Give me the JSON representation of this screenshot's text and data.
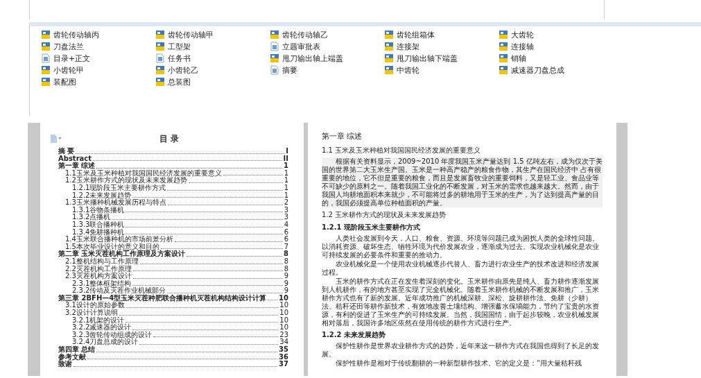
{
  "files": [
    {
      "name": "齿轮传动轴丙",
      "kind": "drawing"
    },
    {
      "name": "齿轮传动轴甲",
      "kind": "drawing"
    },
    {
      "name": "齿轮传动轴乙",
      "kind": "drawing"
    },
    {
      "name": "齿轮组箱体",
      "kind": "drawing"
    },
    {
      "name": "大齿轮",
      "kind": "drawing"
    },
    {
      "name": "刀盘法兰",
      "kind": "drawing"
    },
    {
      "name": "工型架",
      "kind": "drawing"
    },
    {
      "name": "立题审批表",
      "kind": "document"
    },
    {
      "name": "连接架",
      "kind": "drawing"
    },
    {
      "name": "连接轴",
      "kind": "drawing"
    },
    {
      "name": "目录+正文",
      "kind": "document"
    },
    {
      "name": "任务书",
      "kind": "document"
    },
    {
      "name": "甩刀输出轴上端盖",
      "kind": "drawing"
    },
    {
      "name": "甩刀输出轴下端盖",
      "kind": "drawing"
    },
    {
      "name": "销轴",
      "kind": "drawing"
    },
    {
      "name": "小齿轮甲",
      "kind": "drawing"
    },
    {
      "name": "小齿轮乙",
      "kind": "drawing"
    },
    {
      "name": "摘要",
      "kind": "document"
    },
    {
      "name": "中齿轮",
      "kind": "drawing"
    },
    {
      "name": "减速器刀盘总成",
      "kind": "drawing"
    },
    {
      "name": "装配图",
      "kind": "drawing"
    },
    {
      "name": "总装图",
      "kind": "drawing"
    }
  ],
  "toc": {
    "title": "目 录",
    "entries": [
      {
        "label": "摘 要",
        "page": "I"
      },
      {
        "label": "Abstract",
        "page": "II"
      },
      {
        "label": "第一章 综述",
        "page": "1",
        "children": [
          {
            "label": "1.1玉米及玉米种植对我国国民经济发展的重要意义",
            "page": "1"
          },
          {
            "label": "1.2玉米耕作方式的现状及未来发展趋势",
            "page": "1",
            "children": [
              {
                "label": "1.2.1现阶段玉米主要耕作方式",
                "page": "1"
              },
              {
                "label": "1.2.2未来发展趋势",
                "page": "1"
              }
            ]
          },
          {
            "label": "1.3玉米播种机械发展历程与特点",
            "page": "2",
            "children": [
              {
                "label": "1.3.1谷物条播机",
                "page": "3"
              },
              {
                "label": "1.3.2点播机",
                "page": "3"
              },
              {
                "label": "1.3.3联合播种机",
                "page": "4"
              },
              {
                "label": "1.3.4免耕播种机",
                "page": "6"
              }
            ]
          },
          {
            "label": "1.4玉米联合播种机的市场前景分析",
            "page": "6"
          },
          {
            "label": "1.5本次毕业设计的意义和目的",
            "page": "7"
          }
        ]
      },
      {
        "label": "第二章 玉米灭茬机构工作原理及方案设计",
        "page": "8",
        "children": [
          {
            "label": "2.1整机结构与工作原理",
            "page": "8"
          },
          {
            "label": "2.2灭茬机构工作原理",
            "page": "8"
          },
          {
            "label": "2.3灭茬机构方案设计",
            "page": "9",
            "children": [
              {
                "label": "2.3.1整体框架结构",
                "page": "9"
              },
              {
                "label": "2.3.2传动及灭茬作业机械部分",
                "page": "9"
              }
            ]
          }
        ]
      },
      {
        "label": "第三章 2BFH—4型玉米灭茬种肥联合播种机灭茬机构结构设计计算",
        "page": "10",
        "children": [
          {
            "label": "3.1设计的原始参数",
            "page": "10"
          },
          {
            "label": "3.2设计计算说明",
            "page": "10",
            "children": [
              {
                "label": "3.2.1机架的设计",
                "page": "10"
              },
              {
                "label": "3.2.2减速器的设计",
                "page": "10"
              },
              {
                "label": "3.2.3齿轮传动组成的设计",
                "page": "23"
              },
              {
                "label": "3.2.4刀盘总成的设计",
                "page": "34"
              }
            ]
          }
        ]
      },
      {
        "label": "第四章 总结",
        "page": "35"
      },
      {
        "label": "参考文献",
        "page": "36"
      },
      {
        "label": "致谢",
        "page": "37"
      }
    ]
  },
  "body": [
    {
      "kind": "chapter",
      "text": "第一章 综述"
    },
    {
      "kind": "section",
      "text": "1.1 玉米及玉米种植对我国国民经济发展的重要意义"
    },
    {
      "kind": "shaded_paragraph",
      "text": "根据有关资料显示，2009~2010 年度我国玉米产量达到 1.5 亿吨左右，成为仅次于美国的世界第二大玉米生产国。玉米是一种高产稳产的粮食作物，其生产在国民经济中 占有很重要的地位，它不但是重要的粮食，而且是发展畜牧业的重要饲料，又是轻工业、食品业等不可缺少的原料之一。随着我国工业化的不断发展，对玉米的需求也越来越大。然而，由于我国人均耕地面积本来就少，不可能将过多的耕地用于玉米的生产，为了达到提高产量的目的，我国必须提高单位种植面积的产量。"
    },
    {
      "kind": "section",
      "text": "1.2 玉米耕作方式的现状及未来发展趋势"
    },
    {
      "kind": "subsection",
      "text": "1.2.1 现阶段玉米主要耕作方式"
    },
    {
      "kind": "paragraph",
      "text": "人类社会发展到今天，人口、粮食、资源、环境等问题已成为困扰人类的全球性问题。以消耗资源、破坏生态、牺牲环境为代价发展农业，逐渐成为过去。实现农业机械化是农业可持续发展的必要条件和重要的推动力。"
    },
    {
      "kind": "paragraph",
      "text": "农业机械化是一个使用农业机械逐步代替人、畜力进行农业生产的技术改进和经济发展过程。"
    },
    {
      "kind": "paragraph",
      "text": "玉米的耕作方式在正在发生着深刻的变化。玉米耕作由原先是纯人、畜力耕作逐渐发展到人机耕作，有的地方甚至实现了完全机械化。随着玉米耕作机械的不断发展和推广，玉米耕作方式也有了新的发展。近年成功推广的机械深耕、深松、旋耕耕作法、免耕（少耕）法、秸秆还田等耕作新技术，有效地改善土壤结构、增强蓄水保墒能力，节约了宝贵的水资源，有利的促进了玉米生产的可持续发展。当然，我国国情，由于起步较晚，农业机械发展相对落后，我国许多地区依然在使用传统的耕作方式进行生产。"
    },
    {
      "kind": "subsection",
      "text": "1.2.2 未来发展趋势"
    },
    {
      "kind": "paragraph",
      "text": "保护性耕作是世界农业耕作方式的趋势，近年来这一耕作方式在我国也得到了长足的发展。"
    },
    {
      "kind": "paragraph",
      "text": "保护性耕作是相对于传统翻耕的一种新型耕作技术。它的定义是：“用大量秸秆残"
    }
  ]
}
